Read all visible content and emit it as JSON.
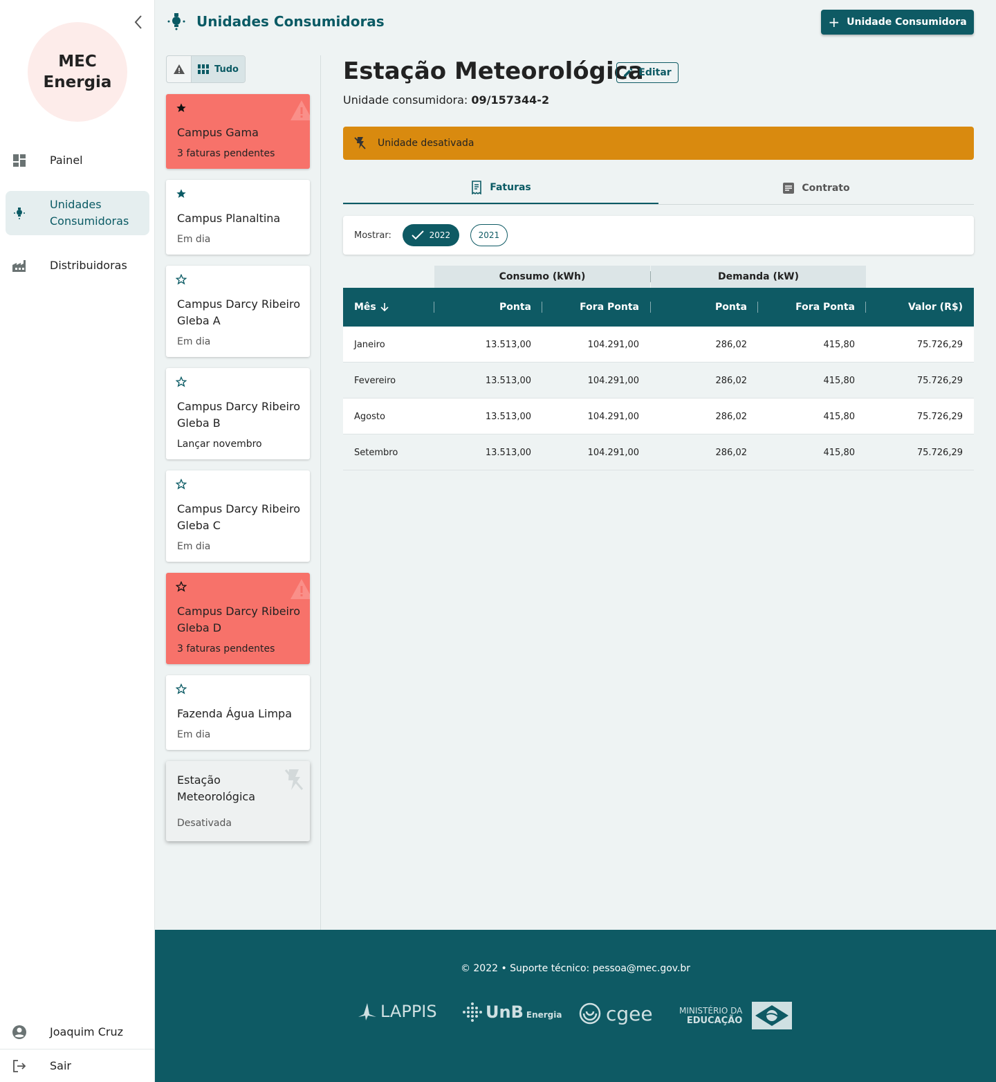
{
  "app": {
    "logo_line1": "MEC",
    "logo_line2": "Energia"
  },
  "sidebar": {
    "items": [
      {
        "label": "Painel",
        "icon": "dashboard-icon"
      },
      {
        "label": "Unidades Consumidoras",
        "icon": "lightbulb-icon",
        "active": true
      },
      {
        "label": "Distribuidoras",
        "icon": "factory-icon"
      }
    ],
    "user_name": "Joaquim Cruz",
    "logout_label": "Sair"
  },
  "header": {
    "title": "Unidades Consumidoras",
    "add_button_label": "Unidade Consumidora"
  },
  "filter": {
    "all_label": "Tudo"
  },
  "cards": [
    {
      "name": "Campus Gama",
      "status": "3 faturas pendentes",
      "favorite": true,
      "state": "alert"
    },
    {
      "name": "Campus Planaltina",
      "status": "Em dia",
      "favorite": true,
      "state": "normal"
    },
    {
      "name": "Campus Darcy Ribeiro Gleba A",
      "status": "Em dia",
      "favorite": false,
      "state": "normal"
    },
    {
      "name": "Campus Darcy Ribeiro Gleba B",
      "status": "Lançar novembro",
      "favorite": false,
      "state": "normal"
    },
    {
      "name": "Campus Darcy Ribeiro Gleba C",
      "status": "Em dia",
      "favorite": false,
      "state": "normal"
    },
    {
      "name": "Campus Darcy Ribeiro Gleba D",
      "status": "3 faturas pendentes",
      "favorite": false,
      "state": "alert"
    },
    {
      "name": "Fazenda Água Limpa",
      "status": "Em dia",
      "favorite": false,
      "state": "normal"
    },
    {
      "name": "Estação Meteorológica",
      "status": "Desativada",
      "favorite": false,
      "state": "disabled"
    }
  ],
  "detail": {
    "title": "Estação Meteorológica",
    "edit_label": "Editar",
    "uc_label": "Unidade consumidora:",
    "uc_number": "09/157344-2",
    "banner_text": "Unidade desativada",
    "tabs": [
      {
        "label": "Faturas",
        "active": true
      },
      {
        "label": "Contrato",
        "active": false
      }
    ],
    "show_label": "Mostrar:",
    "years": [
      {
        "label": "2022",
        "selected": true
      },
      {
        "label": "2021",
        "selected": false
      }
    ]
  },
  "table": {
    "group_headers": [
      "Consumo (kWh)",
      "Demanda (kW)"
    ],
    "columns": [
      "Mês",
      "Ponta",
      "Fora Ponta",
      "Ponta",
      "Fora Ponta",
      "Valor (R$)"
    ],
    "rows": [
      [
        "Janeiro",
        "13.513,00",
        "104.291,00",
        "286,02",
        "415,80",
        "75.726,29"
      ],
      [
        "Fevereiro",
        "13.513,00",
        "104.291,00",
        "286,02",
        "415,80",
        "75.726,29"
      ],
      [
        "Agosto",
        "13.513,00",
        "104.291,00",
        "286,02",
        "415,80",
        "75.726,29"
      ],
      [
        "Setembro",
        "13.513,00",
        "104.291,00",
        "286,02",
        "415,80",
        "75.726,29"
      ]
    ]
  },
  "footer": {
    "copyright": "© 2022  •  Suporte técnico: pessoa@mec.gov.br",
    "partners": [
      "LAPPIS",
      "UnB",
      "Energia",
      "cgee",
      "MINISTÉRIO DA",
      "EDUCAÇÃO"
    ]
  },
  "colors": {
    "primary": "#0e5a64",
    "alert": "#f7726a",
    "warning_banner": "#d98a0f",
    "logo_bg": "#fdecea"
  }
}
